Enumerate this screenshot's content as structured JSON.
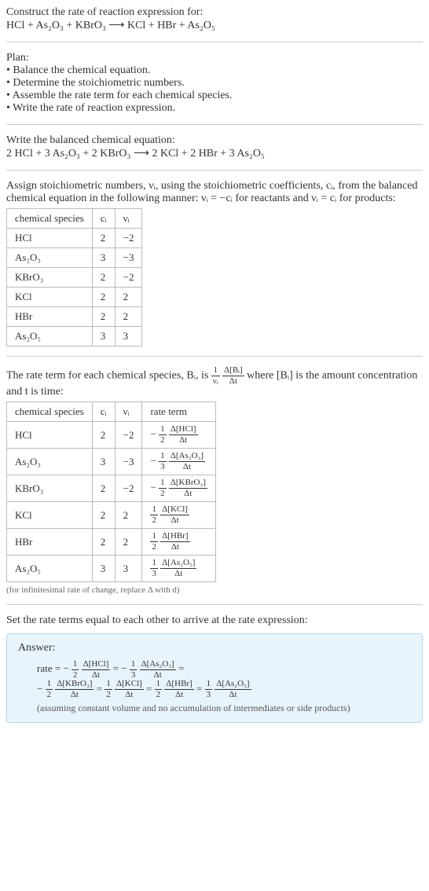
{
  "intro": {
    "title": "Construct the rate of reaction expression for:",
    "equation": "HCl + As₂O₃ + KBrO₃  ⟶  KCl + HBr + As₂O₅"
  },
  "plan": {
    "heading": "Plan:",
    "items": [
      "• Balance the chemical equation.",
      "• Determine the stoichiometric numbers.",
      "• Assemble the rate term for each chemical species.",
      "• Write the rate of reaction expression."
    ]
  },
  "balanced": {
    "heading": "Write the balanced chemical equation:",
    "equation": "2 HCl + 3 As₂O₃ + 2 KBrO₃  ⟶  2 KCl + 2 HBr + 3 As₂O₅"
  },
  "stoich_intro": "Assign stoichiometric numbers, νᵢ, using the stoichiometric coefficients, cᵢ, from the balanced chemical equation in the following manner: νᵢ = −cᵢ for reactants and νᵢ = cᵢ for products:",
  "stoich_table": {
    "headers": [
      "chemical species",
      "cᵢ",
      "νᵢ"
    ],
    "rows": [
      [
        "HCl",
        "2",
        "−2"
      ],
      [
        "As₂O₃",
        "3",
        "−3"
      ],
      [
        "KBrO₃",
        "2",
        "−2"
      ],
      [
        "KCl",
        "2",
        "2"
      ],
      [
        "HBr",
        "2",
        "2"
      ],
      [
        "As₂O₅",
        "3",
        "3"
      ]
    ]
  },
  "rate_intro_a": "The rate term for each chemical species, Bᵢ, is ",
  "rate_intro_b": " where [Bᵢ] is the amount concentration and t is time:",
  "rate_table": {
    "headers": [
      "chemical species",
      "cᵢ",
      "νᵢ",
      "rate term"
    ],
    "rows": [
      {
        "sp": "HCl",
        "c": "2",
        "v": "−2",
        "sign": "−",
        "coef_num": "1",
        "coef_den": "2",
        "d_num": "Δ[HCl]",
        "d_den": "Δt"
      },
      {
        "sp": "As₂O₃",
        "c": "3",
        "v": "−3",
        "sign": "−",
        "coef_num": "1",
        "coef_den": "3",
        "d_num": "Δ[As₂O₃]",
        "d_den": "Δt"
      },
      {
        "sp": "KBrO₃",
        "c": "2",
        "v": "−2",
        "sign": "−",
        "coef_num": "1",
        "coef_den": "2",
        "d_num": "Δ[KBrO₃]",
        "d_den": "Δt"
      },
      {
        "sp": "KCl",
        "c": "2",
        "v": "2",
        "sign": "",
        "coef_num": "1",
        "coef_den": "2",
        "d_num": "Δ[KCl]",
        "d_den": "Δt"
      },
      {
        "sp": "HBr",
        "c": "2",
        "v": "2",
        "sign": "",
        "coef_num": "1",
        "coef_den": "2",
        "d_num": "Δ[HBr]",
        "d_den": "Δt"
      },
      {
        "sp": "As₂O₅",
        "c": "3",
        "v": "3",
        "sign": "",
        "coef_num": "1",
        "coef_den": "3",
        "d_num": "Δ[As₂O₅]",
        "d_den": "Δt"
      }
    ]
  },
  "rate_note": "(for infinitesimal rate of change, replace Δ with d)",
  "set_equal": "Set the rate terms equal to each other to arrive at the rate expression:",
  "answer": {
    "label": "Answer:",
    "prefix": "rate = ",
    "terms": [
      {
        "sign": "−",
        "coef_num": "1",
        "coef_den": "2",
        "d_num": "Δ[HCl]",
        "d_den": "Δt"
      },
      {
        "sign": "−",
        "coef_num": "1",
        "coef_den": "3",
        "d_num": "Δ[As₂O₃]",
        "d_den": "Δt"
      },
      {
        "sign": "−",
        "coef_num": "1",
        "coef_den": "2",
        "d_num": "Δ[KBrO₃]",
        "d_den": "Δt"
      },
      {
        "sign": "",
        "coef_num": "1",
        "coef_den": "2",
        "d_num": "Δ[KCl]",
        "d_den": "Δt"
      },
      {
        "sign": "",
        "coef_num": "1",
        "coef_den": "2",
        "d_num": "Δ[HBr]",
        "d_den": "Δt"
      },
      {
        "sign": "",
        "coef_num": "1",
        "coef_den": "3",
        "d_num": "Δ[As₂O₅]",
        "d_den": "Δt"
      }
    ],
    "note": "(assuming constant volume and no accumulation of intermediates or side products)"
  },
  "chart_data": {
    "type": "table",
    "tables": [
      {
        "title": "Stoichiometric numbers",
        "headers": [
          "chemical species",
          "c_i",
          "ν_i"
        ],
        "rows": [
          [
            "HCl",
            2,
            -2
          ],
          [
            "As2O3",
            3,
            -3
          ],
          [
            "KBrO3",
            2,
            -2
          ],
          [
            "KCl",
            2,
            2
          ],
          [
            "HBr",
            2,
            2
          ],
          [
            "As2O5",
            3,
            3
          ]
        ]
      },
      {
        "title": "Rate terms",
        "headers": [
          "chemical species",
          "c_i",
          "ν_i",
          "rate term"
        ],
        "rows": [
          [
            "HCl",
            2,
            -2,
            "-(1/2) Δ[HCl]/Δt"
          ],
          [
            "As2O3",
            3,
            -3,
            "-(1/3) Δ[As2O3]/Δt"
          ],
          [
            "KBrO3",
            2,
            -2,
            "-(1/2) Δ[KBrO3]/Δt"
          ],
          [
            "KCl",
            2,
            2,
            "(1/2) Δ[KCl]/Δt"
          ],
          [
            "HBr",
            2,
            2,
            "(1/2) Δ[HBr]/Δt"
          ],
          [
            "As2O5",
            3,
            3,
            "(1/3) Δ[As2O5]/Δt"
          ]
        ]
      }
    ]
  }
}
